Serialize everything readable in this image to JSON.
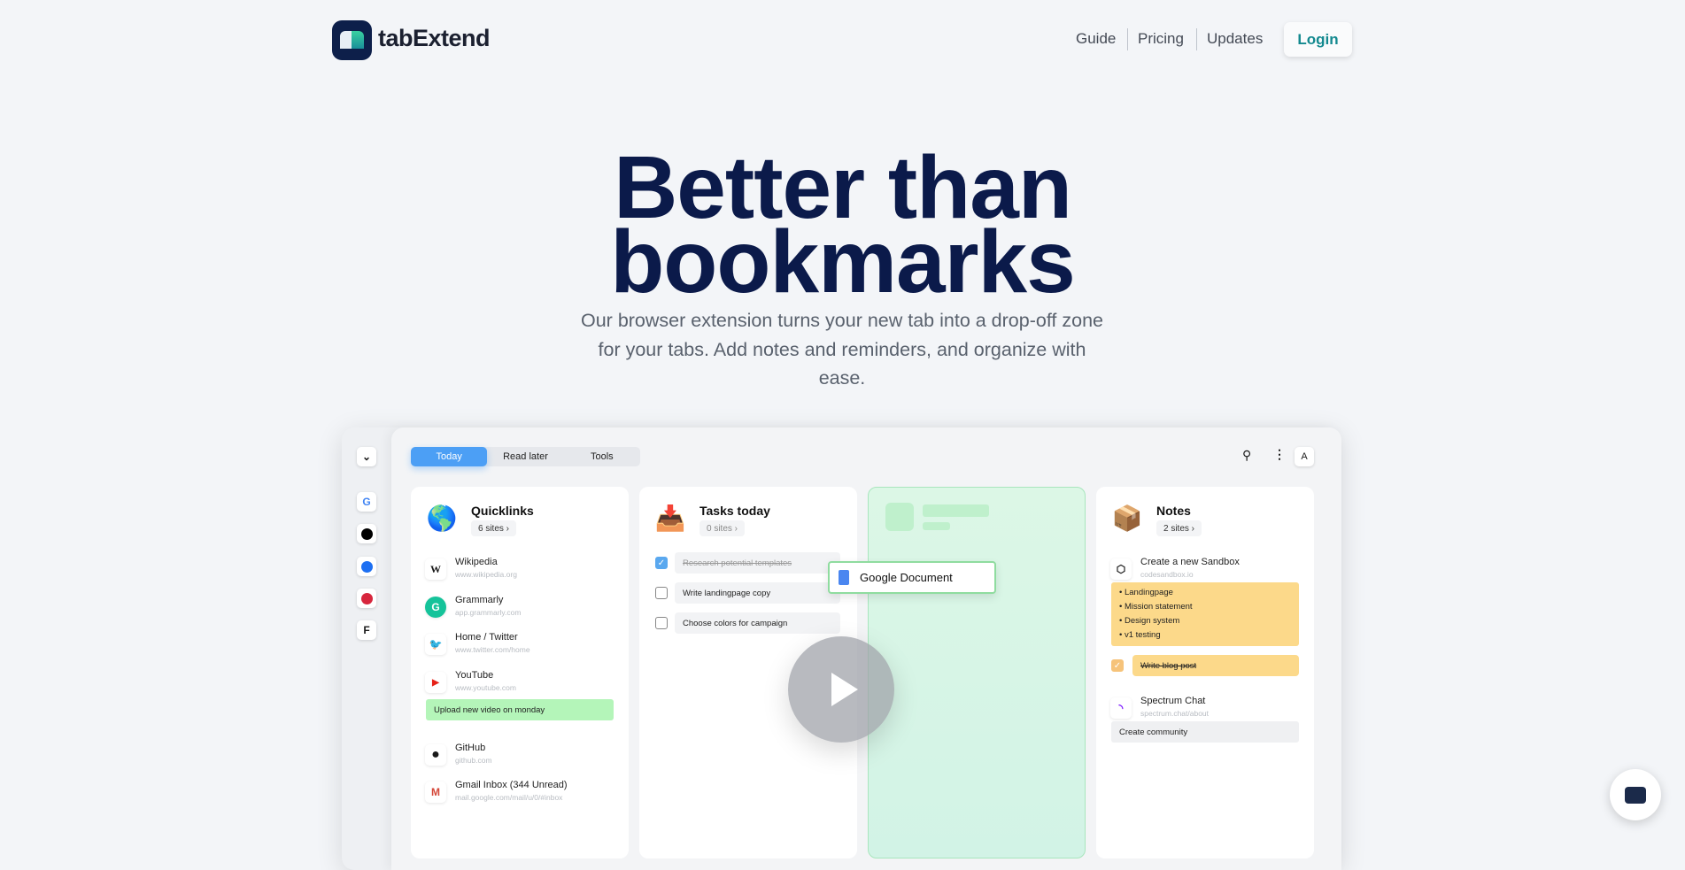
{
  "header": {
    "brand": "tabExtend",
    "nav": [
      "Guide",
      "Pricing",
      "Updates"
    ],
    "login": "Login",
    "accent": "#13898f"
  },
  "hero": {
    "title_line1": "Better than",
    "title_line2": "bookmarks",
    "subtitle": "Our browser extension turns your new tab into a drop-off zone for your tabs. Add notes and reminders, and organize with ease.",
    "title_color": "#0b1a4a"
  },
  "app": {
    "sidebar": {
      "icons": [
        "chevron-down-icon",
        "google-icon",
        "drive-icon",
        "safari-icon",
        "pinterest-icon",
        "framer-icon"
      ]
    },
    "tabs": [
      {
        "label": "Today",
        "active": true
      },
      {
        "label": "Read later"
      },
      {
        "label": "Tools"
      }
    ],
    "avatar": "A",
    "quicklinks": {
      "title": "Quicklinks",
      "count": "6 sites ›",
      "links": [
        {
          "name": "Wikipedia",
          "url": "www.wikipedia.org",
          "icon": "W"
        },
        {
          "name": "Grammarly",
          "url": "app.grammarly.com",
          "icon": "G"
        },
        {
          "name": "Home / Twitter",
          "url": "www.twitter.com/home",
          "icon": "🐦"
        },
        {
          "name": "YouTube",
          "url": "www.youtube.com",
          "icon": "▶"
        }
      ],
      "note": "Upload new video on monday",
      "links2": [
        {
          "name": "GitHub",
          "url": "github.com",
          "icon": "●"
        },
        {
          "name": "Gmail Inbox (344 Unread)",
          "url": "mail.google.com/mail/u/0/#inbox",
          "icon": "M"
        }
      ]
    },
    "tasks": {
      "title": "Tasks today",
      "count": "0 sites ›",
      "items": [
        {
          "label": "Research potential templates",
          "done": true
        },
        {
          "label": "Write landingpage copy",
          "done": false
        },
        {
          "label": "Choose colors for campaign",
          "done": false
        }
      ]
    },
    "drag_card": "Google Document",
    "notes": {
      "title": "Notes",
      "count": "2 sites ›",
      "sandbox": {
        "name": "Create a new Sandbox",
        "url": "codesandbox.io"
      },
      "bullets": [
        "• Landingpage",
        "• Mission statement",
        "• Design system",
        "• v1 testing"
      ],
      "blog": "Write blog post",
      "spectrum": {
        "name": "Spectrum Chat",
        "url": "spectrum.chat/about"
      },
      "community": "Create community"
    }
  }
}
